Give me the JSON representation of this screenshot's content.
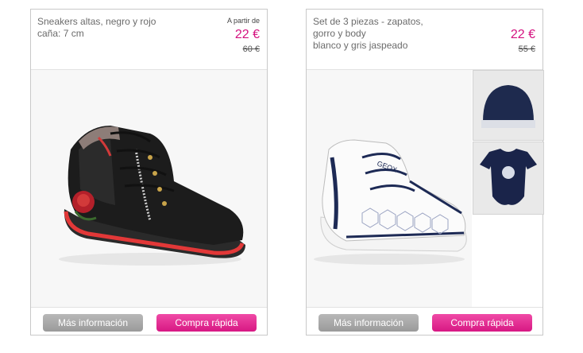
{
  "products": [
    {
      "title_lines": [
        "Sneakers altas, negro y rojo",
        "caña: 7 cm"
      ],
      "from_label": "A partir de",
      "price": "22 €",
      "old_price": "60 €",
      "image": "black-red-hightop-sneaker",
      "info_label": "Más información",
      "buy_label": "Compra rápida"
    },
    {
      "title_lines": [
        "Set de 3 piezas - zapatos,",
        "gorro y body",
        "blanco y gris jaspeado"
      ],
      "price": "22 €",
      "old_price": "55 €",
      "image": "white-baby-sneaker",
      "thumbnails": [
        "navy-baby-hat",
        "navy-baby-bodysuit"
      ],
      "info_label": "Más información",
      "buy_label": "Compra rápida"
    }
  ],
  "colors": {
    "price": "#d4117f",
    "buy_button": "#e0268f",
    "info_button": "#a8a8a8"
  }
}
